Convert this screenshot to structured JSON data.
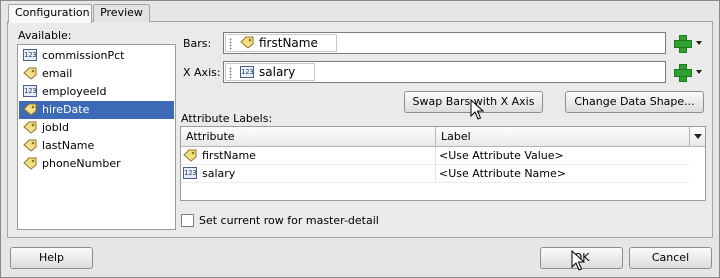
{
  "tabs": [
    {
      "label": "Configuration",
      "active": true
    },
    {
      "label": "Preview",
      "active": false
    }
  ],
  "available": {
    "label": "Available:",
    "items": [
      {
        "label": "commissionPct",
        "icon": "number-icon"
      },
      {
        "label": "email",
        "icon": "tag-icon"
      },
      {
        "label": "employeeId",
        "icon": "number-icon"
      },
      {
        "label": "hireDate",
        "icon": "tag-icon",
        "selected": true
      },
      {
        "label": "jobId",
        "icon": "tag-icon"
      },
      {
        "label": "lastName",
        "icon": "tag-icon"
      },
      {
        "label": "phoneNumber",
        "icon": "tag-icon"
      }
    ]
  },
  "bars": {
    "label": "Bars:",
    "value": "firstName",
    "icon": "tag-icon"
  },
  "xaxis": {
    "label": "X Axis:",
    "value": "salary",
    "icon": "number-icon"
  },
  "buttons": {
    "swap": "Swap Bars with X Axis",
    "change_shape": "Change Data Shape...",
    "help": "Help",
    "ok": "OK",
    "cancel": "Cancel"
  },
  "attribute_labels": {
    "label": "Attribute Labels:",
    "columns": [
      "Attribute",
      "Label"
    ],
    "rows": [
      {
        "attribute": "firstName",
        "icon": "tag-icon",
        "label": "<Use Attribute Value>"
      },
      {
        "attribute": "salary",
        "icon": "number-icon",
        "label": "<Use Attribute Name>"
      }
    ]
  },
  "master_detail": {
    "label": "Set current row for master-detail",
    "checked": false
  },
  "icon_text": {
    "number": "123"
  },
  "colors": {
    "selection": "#3d6ab6",
    "add_green": "#2fa02f"
  }
}
